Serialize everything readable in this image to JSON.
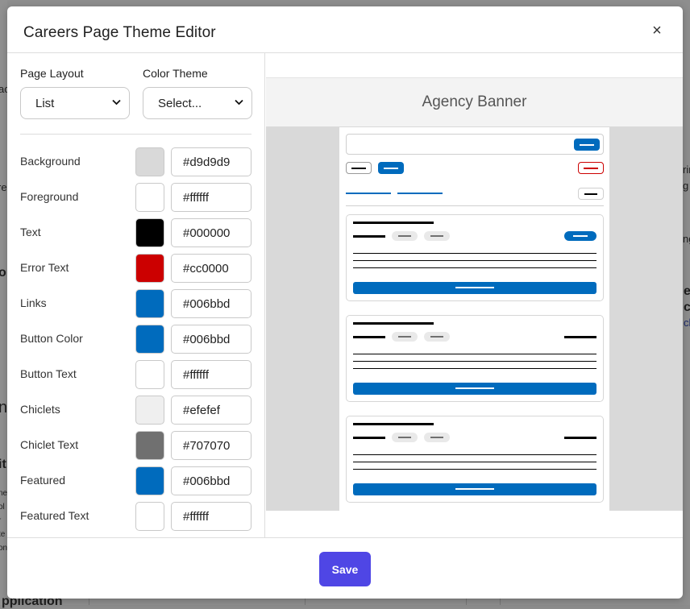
{
  "modal": {
    "title": "Careers Page Theme Editor",
    "close_label": "×"
  },
  "settings": {
    "layout_label": "Page Layout",
    "layout_value": "List",
    "theme_label": "Color Theme",
    "theme_value": "Select...",
    "colors": [
      {
        "label": "Background",
        "hex": "#d9d9d9"
      },
      {
        "label": "Foreground",
        "hex": "#ffffff"
      },
      {
        "label": "Text",
        "hex": "#000000"
      },
      {
        "label": "Error Text",
        "hex": "#cc0000"
      },
      {
        "label": "Links",
        "hex": "#006bbd"
      },
      {
        "label": "Button Color",
        "hex": "#006bbd"
      },
      {
        "label": "Button Text",
        "hex": "#ffffff"
      },
      {
        "label": "Chiclets",
        "hex": "#efefef"
      },
      {
        "label": "Chiclet Text",
        "hex": "#707070"
      },
      {
        "label": "Featured",
        "hex": "#006bbd"
      },
      {
        "label": "Featured Text",
        "hex": "#ffffff"
      }
    ]
  },
  "preview": {
    "banner_text": "Agency Banner"
  },
  "footer": {
    "save_label": "Save"
  },
  "background_page": {
    "fragments": [
      "ac",
      "rin",
      "g",
      "ng",
      "ed",
      "cc",
      "ch",
      "re",
      "o",
      "n",
      "it",
      "ne",
      "ol",
      "r",
      "te",
      "on",
      "pplication"
    ]
  }
}
